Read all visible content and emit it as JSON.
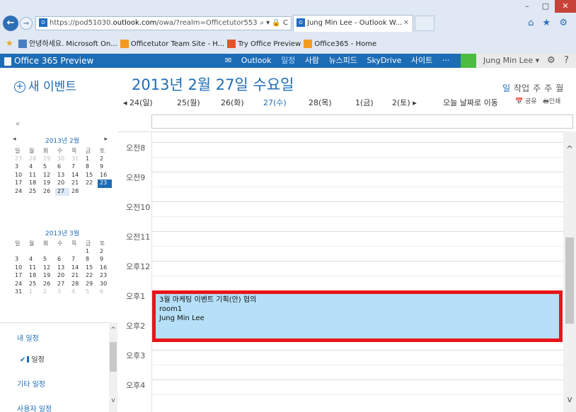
{
  "browser": {
    "window_buttons": [
      "–",
      "▢",
      "✕"
    ],
    "url_prefix": "https://pod51030.",
    "url_domain": "outlook.com",
    "url_suffix": "/owa/?realm=Officetutor553.on",
    "url_tools": "⌕ ▾ 🔒 C",
    "tab_title": "Jung Min Lee - Outlook W...",
    "tab_close": "✕",
    "toolbar_icons": "⌂ ★ ⚙",
    "favorites": [
      {
        "label": "안녕하세요. Microsoft On...",
        "icon_color": "#4a7fc0"
      },
      {
        "label": "Officetutor Team Site - H...",
        "icon_color": "#f29b21"
      },
      {
        "label": "Try Office Preview",
        "icon_color": "#e2542b"
      },
      {
        "label": "Office365 - Home",
        "icon_color": "#f29b21"
      }
    ]
  },
  "o365": {
    "logo": "Office 365 Preview",
    "nav": {
      "mail_icon": "✉",
      "outlook": "Outlook",
      "calendar": "일정",
      "people": "사람",
      "newsfeed": "뉴스피드",
      "skydrive": "SkyDrive",
      "sites": "사이트",
      "more": "···"
    },
    "user": "Jung Min Lee ▾",
    "settings_icon": "⚙",
    "help_icon": "?"
  },
  "left": {
    "new_event": "새 이벤트",
    "collapse": "«",
    "calendars": [
      {
        "title": "2013년 2월",
        "prev": "◂",
        "next": "▸",
        "weekdays": [
          "일",
          "월",
          "화",
          "수",
          "목",
          "금",
          "토"
        ],
        "weeks": [
          [
            {
              "d": "27",
              "c": "dim"
            },
            {
              "d": "28",
              "c": "dim"
            },
            {
              "d": "29",
              "c": "dim"
            },
            {
              "d": "30",
              "c": "dim"
            },
            {
              "d": "31",
              "c": "dim"
            },
            {
              "d": "1"
            },
            {
              "d": "2"
            }
          ],
          [
            {
              "d": "3"
            },
            {
              "d": "4"
            },
            {
              "d": "5"
            },
            {
              "d": "6"
            },
            {
              "d": "7"
            },
            {
              "d": "8"
            },
            {
              "d": "9"
            }
          ],
          [
            {
              "d": "10"
            },
            {
              "d": "11"
            },
            {
              "d": "12"
            },
            {
              "d": "13"
            },
            {
              "d": "14"
            },
            {
              "d": "15"
            },
            {
              "d": "16"
            }
          ],
          [
            {
              "d": "17"
            },
            {
              "d": "18"
            },
            {
              "d": "19"
            },
            {
              "d": "20"
            },
            {
              "d": "21"
            },
            {
              "d": "22"
            },
            {
              "d": "23",
              "c": "sel"
            }
          ],
          [
            {
              "d": "24"
            },
            {
              "d": "25"
            },
            {
              "d": "26"
            },
            {
              "d": "27",
              "c": "wk"
            },
            {
              "d": "28"
            },
            {
              "d": ""
            },
            {
              "d": ""
            }
          ]
        ]
      },
      {
        "title": "2013년 3월",
        "prev": "",
        "next": "",
        "weekdays": [
          "일",
          "월",
          "화",
          "수",
          "목",
          "금",
          "토"
        ],
        "weeks": [
          [
            {
              "d": ""
            },
            {
              "d": ""
            },
            {
              "d": ""
            },
            {
              "d": ""
            },
            {
              "d": ""
            },
            {
              "d": "1"
            },
            {
              "d": "2"
            }
          ],
          [
            {
              "d": "3"
            },
            {
              "d": "4"
            },
            {
              "d": "5"
            },
            {
              "d": "6"
            },
            {
              "d": "7"
            },
            {
              "d": "8"
            },
            {
              "d": "9"
            }
          ],
          [
            {
              "d": "10"
            },
            {
              "d": "11"
            },
            {
              "d": "12"
            },
            {
              "d": "13"
            },
            {
              "d": "14"
            },
            {
              "d": "15"
            },
            {
              "d": "16"
            }
          ],
          [
            {
              "d": "17"
            },
            {
              "d": "18"
            },
            {
              "d": "19"
            },
            {
              "d": "20"
            },
            {
              "d": "21"
            },
            {
              "d": "22"
            },
            {
              "d": "23"
            }
          ],
          [
            {
              "d": "24"
            },
            {
              "d": "25"
            },
            {
              "d": "26"
            },
            {
              "d": "27"
            },
            {
              "d": "28"
            },
            {
              "d": "29"
            },
            {
              "d": "30"
            }
          ],
          [
            {
              "d": "31"
            },
            {
              "d": "1",
              "c": "dim"
            },
            {
              "d": "2",
              "c": "dim"
            },
            {
              "d": "3",
              "c": "dim"
            },
            {
              "d": "4",
              "c": "dim"
            },
            {
              "d": "5",
              "c": "dim"
            },
            {
              "d": "6",
              "c": "dim"
            }
          ]
        ]
      }
    ],
    "my_calendars": "내 일정",
    "my_calendar_item": "일정",
    "my_calendar_check": "✔",
    "other_calendars": "기타 일정",
    "user_calendars": "사용자 일정",
    "scroll_up": "^",
    "scroll_down": "v"
  },
  "main": {
    "date_title": "2013년 2월 27일 수요일",
    "days": [
      "◂ 24(일)",
      "25(월)",
      "26(화)",
      "27(수)",
      "28(목)",
      "1(금)",
      "2(토) ▸"
    ],
    "goto_today": "오늘 날짜로 이동",
    "views": [
      "일",
      "작업",
      "주",
      "주",
      "월"
    ],
    "share": "공유",
    "print": "인쇄",
    "share_icon": "📅",
    "print_icon": "🖶",
    "hours": [
      "오전8",
      "오전9",
      "오전10",
      "오전11",
      "오후12",
      "오후1",
      "오후2",
      "오후3",
      "오후4"
    ],
    "event": {
      "title": "3월 마케팅 이벤트 기획(안) 협의",
      "location": "room1",
      "organizer": "Jung Min Lee",
      "fill": "#b5e0f7",
      "highlight": "#e8151a"
    },
    "scroll_up": "^",
    "scroll_down": "v"
  }
}
